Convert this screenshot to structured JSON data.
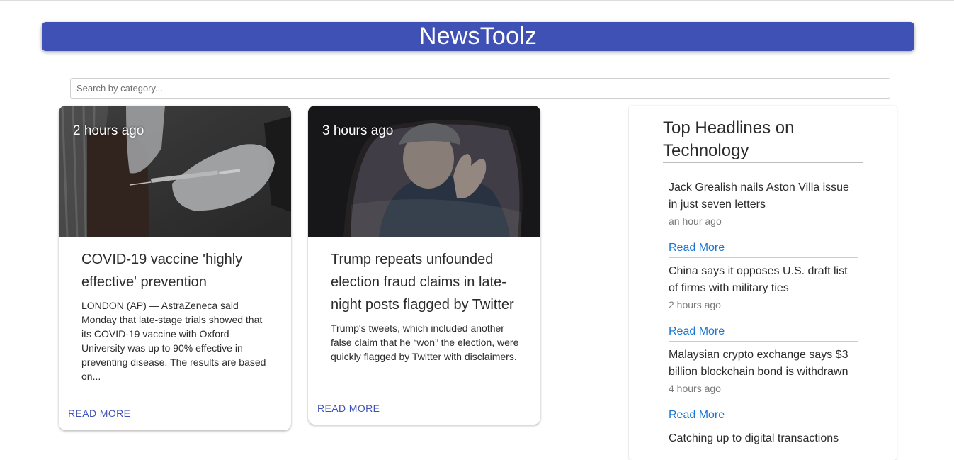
{
  "app": {
    "title": "NewsToolz"
  },
  "search": {
    "placeholder": "Search by category..."
  },
  "cards": [
    {
      "time": "2 hours ago",
      "title": "COVID-19 vaccine 'highly effective' prevention",
      "description": "LONDON (AP) — AstraZeneca said Monday that late-stage trials showed that its COVID-19 vaccine with Oxford University was up to 90% effective in preventing disease. The results are based on...",
      "action": "READ MORE"
    },
    {
      "time": "3 hours ago",
      "title": "Trump repeats unfounded election fraud claims in late-night posts flagged by Twitter",
      "description": "Trump's tweets, which included another false claim that he “won” the election, were quickly flagged by Twitter with disclaimers.",
      "action": "READ MORE"
    }
  ],
  "sidebar": {
    "title": "Top Headlines on Technology",
    "items": [
      {
        "title": "Jack Grealish nails Aston Villa issue in just seven letters",
        "time": "an hour ago",
        "link": "Read More"
      },
      {
        "title": "China says it opposes U.S. draft list of firms with military ties",
        "time": "2 hours ago",
        "link": "Read More"
      },
      {
        "title": "Malaysian crypto exchange says $3 billion blockchain bond is withdrawn",
        "time": "4 hours ago",
        "link": "Read More"
      },
      {
        "title": "Catching up to digital transactions"
      }
    ]
  },
  "colors": {
    "appbar": "#3f51b5",
    "card_action": "#3f51b5",
    "link": "#1976d2"
  }
}
